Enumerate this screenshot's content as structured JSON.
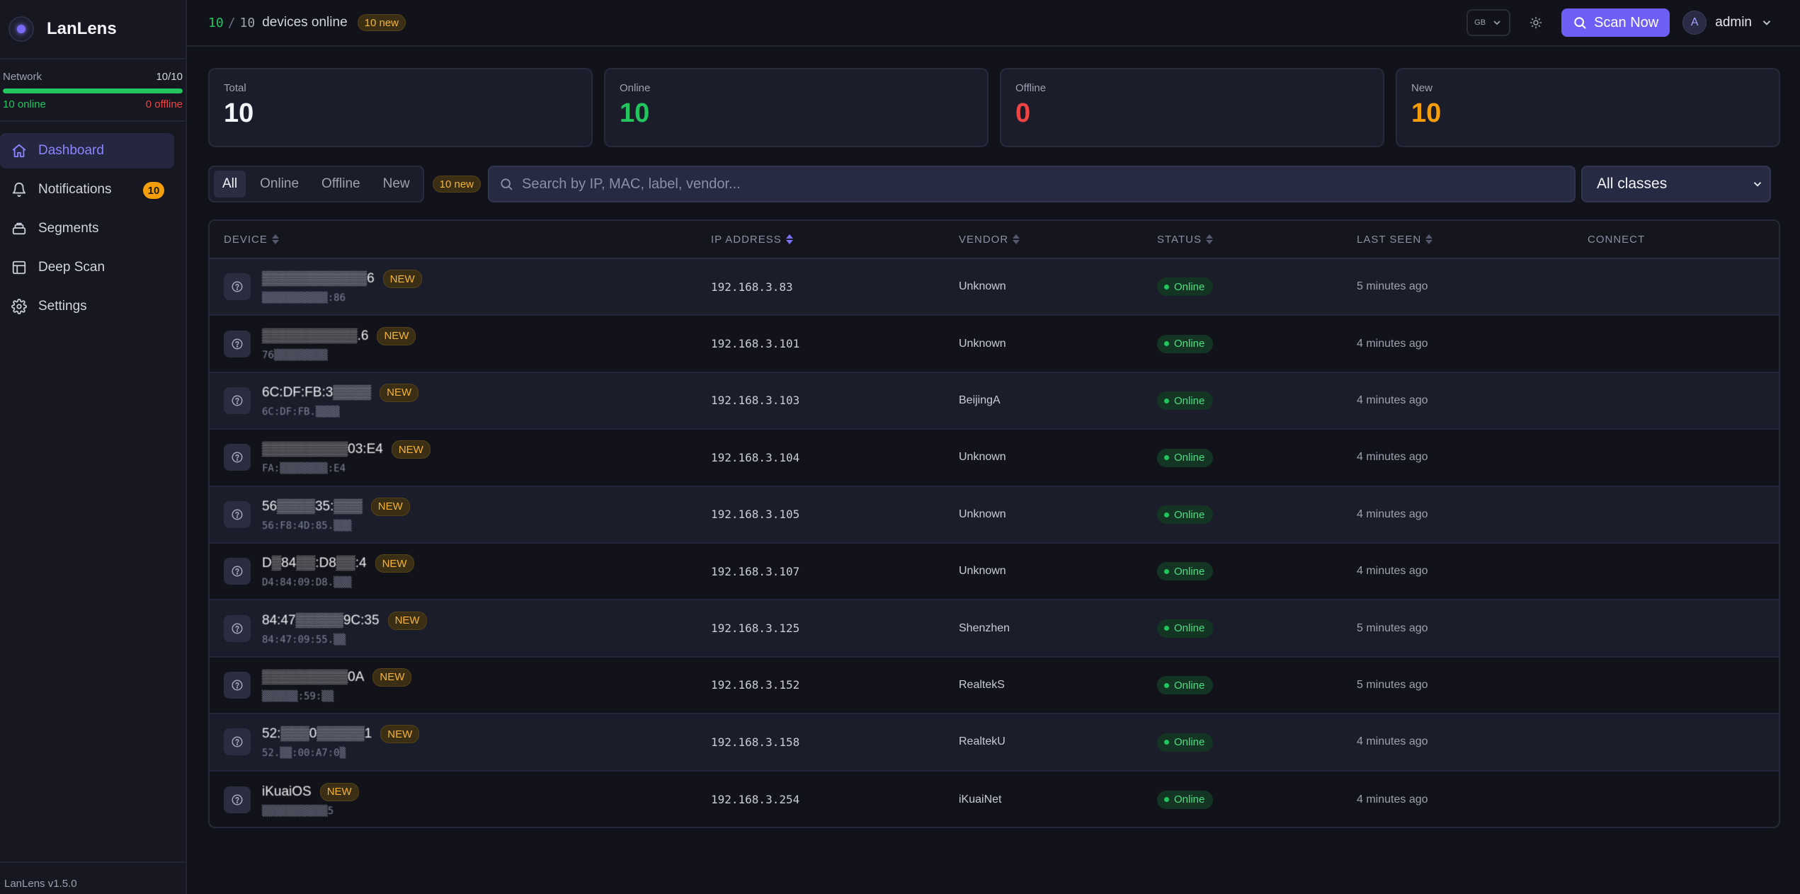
{
  "brand": {
    "name": "LanLens",
    "version": "LanLens v1.5.0"
  },
  "network": {
    "label": "Network",
    "ratio": "10/10",
    "online_text": "10 online",
    "offline_text": "0 offline",
    "online_fraction": 1.0,
    "bar_color": "#22c55e"
  },
  "nav": [
    {
      "label": "Dashboard",
      "icon": "home-icon",
      "active": true,
      "badge": null
    },
    {
      "label": "Notifications",
      "icon": "bell-icon",
      "active": false,
      "badge": "10"
    },
    {
      "label": "Segments",
      "icon": "layers-icon",
      "active": false,
      "badge": null
    },
    {
      "label": "Deep Scan",
      "icon": "table-icon",
      "active": false,
      "badge": null
    },
    {
      "label": "Settings",
      "icon": "gear-icon",
      "active": false,
      "badge": null
    }
  ],
  "topbar": {
    "online_count": "10",
    "slash": "/",
    "total_count": "10",
    "devices_online_label": "devices online",
    "new_tag": "10 new",
    "lang_label": "GB",
    "scan_button": "Scan Now",
    "user_initial": "A",
    "user_name": "admin"
  },
  "stats": [
    {
      "label": "Total",
      "value": "10",
      "color": "#f3f4f6"
    },
    {
      "label": "Online",
      "value": "10",
      "color": "#22c55e"
    },
    {
      "label": "Offline",
      "value": "0",
      "color": "#ef4444"
    },
    {
      "label": "New",
      "value": "10",
      "color": "#f59e0b"
    }
  ],
  "filters": {
    "tabs": [
      "All",
      "Online",
      "Offline",
      "New"
    ],
    "active_tab": "All",
    "new_tag": "10 new",
    "search_placeholder": "Search by IP, MAC, label, vendor...",
    "class_select": "All classes"
  },
  "table": {
    "columns": {
      "device": "DEVICE",
      "ip": "IP ADDRESS",
      "vendor": "VENDOR",
      "status": "STATUS",
      "last_seen": "LAST SEEN",
      "connect": "CONNECT"
    },
    "sorted_column": "ip",
    "new_badge": "NEW",
    "rows": [
      {
        "name": "▒▒▒▒▒▒▒▒▒▒▒6",
        "mac": "▒▒▒▒▒▒▒▒▒▒▒:86",
        "ip": "192.168.3.83",
        "vendor": "Unknown",
        "status": "Online",
        "last_seen": "5 minutes ago"
      },
      {
        "name": "▒▒▒▒▒▒▒▒▒▒.6",
        "mac": "76▒▒▒▒▒▒▒▒▒",
        "ip": "192.168.3.101",
        "vendor": "Unknown",
        "status": "Online",
        "last_seen": "4 minutes ago"
      },
      {
        "name": "6C:DF:FB:3▒▒▒▒",
        "mac": "6C:DF:FB.▒▒▒▒",
        "ip": "192.168.3.103",
        "vendor": "BeijingA",
        "status": "Online",
        "last_seen": "4 minutes ago"
      },
      {
        "name": "▒▒▒▒▒▒▒▒▒03:E4",
        "mac": "FA:▒▒▒▒▒▒▒▒:E4",
        "ip": "192.168.3.104",
        "vendor": "Unknown",
        "status": "Online",
        "last_seen": "4 minutes ago"
      },
      {
        "name": "56▒▒▒▒35:▒▒▒",
        "mac": "56:F8:4D:85.▒▒▒",
        "ip": "192.168.3.105",
        "vendor": "Unknown",
        "status": "Online",
        "last_seen": "4 minutes ago"
      },
      {
        "name": "D▒84▒▒:D8▒▒:4",
        "mac": "D4:84:09:D8.▒▒▒",
        "ip": "192.168.3.107",
        "vendor": "Unknown",
        "status": "Online",
        "last_seen": "4 minutes ago"
      },
      {
        "name": "84:47▒▒▒▒▒9C:35",
        "mac": "84:47:09:55.▒▒",
        "ip": "192.168.3.125",
        "vendor": "Shenzhen",
        "status": "Online",
        "last_seen": "5 minutes ago"
      },
      {
        "name": "▒▒▒▒▒▒▒▒▒0A",
        "mac": "▒▒▒▒▒▒:59:▒▒",
        "ip": "192.168.3.152",
        "vendor": "RealtekS",
        "status": "Online",
        "last_seen": "5 minutes ago"
      },
      {
        "name": "52:▒▒▒0▒▒▒▒▒1",
        "mac": "52.▒▒:00:A7:0▒",
        "ip": "192.168.3.158",
        "vendor": "RealtekU",
        "status": "Online",
        "last_seen": "4 minutes ago"
      },
      {
        "name": "iKuaiOS",
        "mac": "▒▒▒▒▒▒▒▒▒▒▒5",
        "ip": "192.168.3.254",
        "vendor": "iKuaiNet",
        "status": "Online",
        "last_seen": "4 minutes ago"
      }
    ]
  }
}
